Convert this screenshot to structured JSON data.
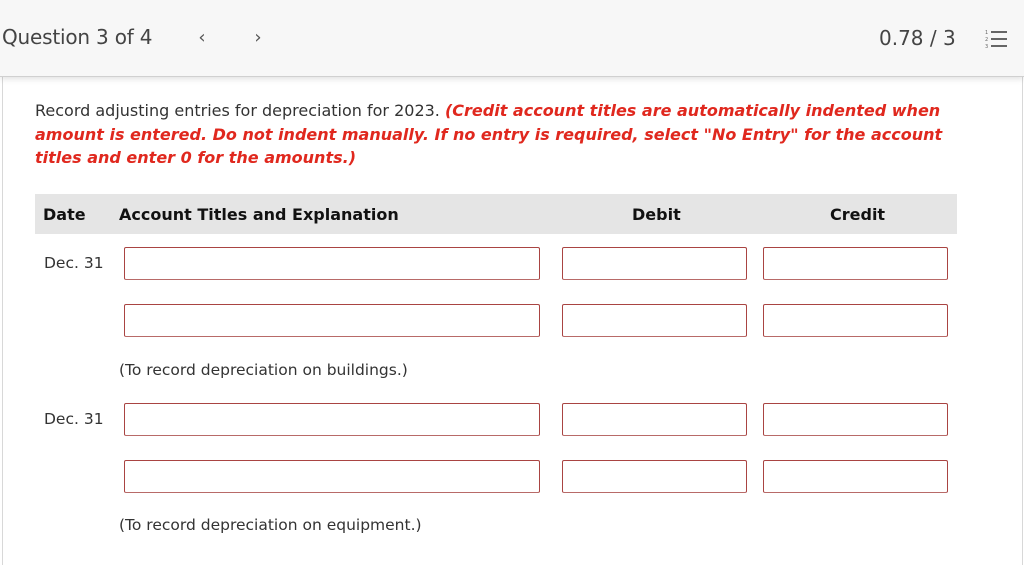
{
  "header": {
    "question_label": "Question 3 of 4",
    "prev_icon": "chevron-left-icon",
    "prev_glyph": "‹",
    "next_icon": "chevron-right-icon",
    "next_glyph": "›",
    "score": "0.78 / 3",
    "question_list_icon": "numbered-list-icon"
  },
  "instructions": {
    "plain": "Record adjusting entries for depreciation for 2023. ",
    "emphasis": "(Credit account titles are automatically indented when amount is entered. Do not indent manually. If no entry is required, select \"No Entry\" for the account titles and enter 0 for the amounts.)",
    "emphasis_color": "#e0281e"
  },
  "table": {
    "columns": {
      "date": "Date",
      "account": "Account Titles and Explanation",
      "debit": "Debit",
      "credit": "Credit"
    },
    "entries": [
      {
        "date": "Dec. 31",
        "rows": [
          {
            "account": "",
            "debit": "",
            "credit": ""
          },
          {
            "account": "",
            "debit": "",
            "credit": ""
          }
        ],
        "explanation": "(To record depreciation on buildings.)"
      },
      {
        "date": "Dec. 31",
        "rows": [
          {
            "account": "",
            "debit": "",
            "credit": ""
          },
          {
            "account": "",
            "debit": "",
            "credit": ""
          }
        ],
        "explanation": "(To record depreciation on equipment.)"
      }
    ]
  },
  "colors": {
    "field_border": "#a94442",
    "header_bg": "#e5e5e5",
    "topbar_bg": "#f7f7f7"
  }
}
